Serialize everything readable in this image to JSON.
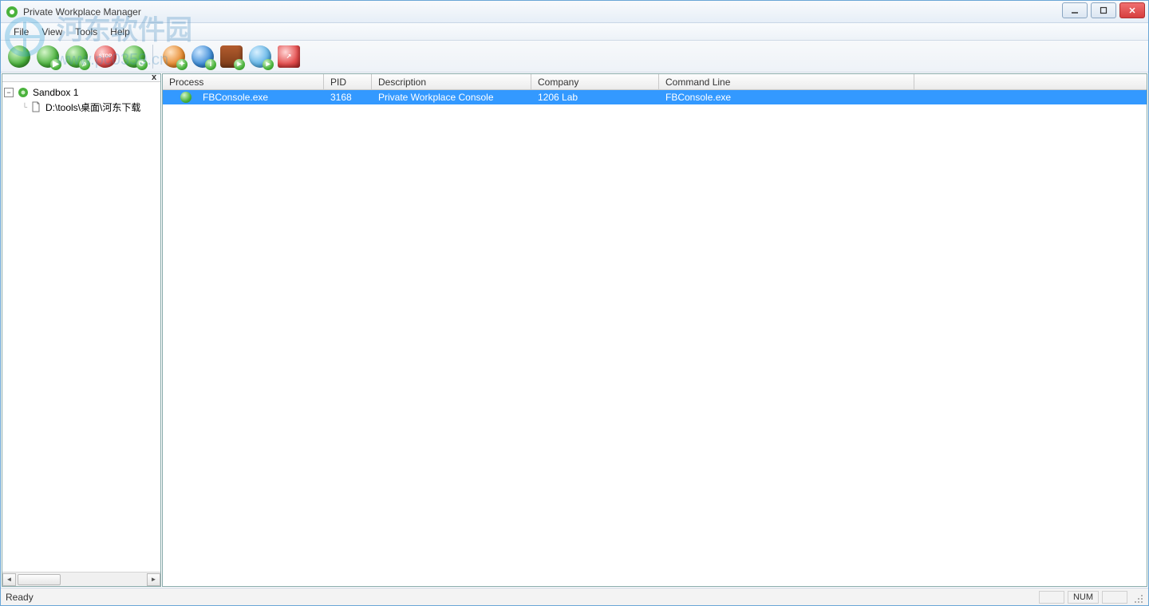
{
  "window": {
    "title": "Private Workplace Manager"
  },
  "menu": {
    "items": [
      "File",
      "View",
      "Tools",
      "Help"
    ]
  },
  "toolbar": {
    "buttons": [
      {
        "name": "new-sandbox",
        "style": "green",
        "glyph": ""
      },
      {
        "name": "play-sandbox",
        "style": "green",
        "glyph": "▶"
      },
      {
        "name": "explore-sandbox",
        "style": "green",
        "glyph": ""
      },
      {
        "name": "stop-sandbox",
        "style": "red",
        "glyph": "STOP"
      },
      {
        "name": "refresh",
        "style": "green",
        "glyph": "⟳"
      },
      {
        "sep": true
      },
      {
        "name": "settings",
        "style": "orange",
        "glyph": "✦"
      },
      {
        "name": "info",
        "style": "blue",
        "glyph": "i"
      },
      {
        "name": "catalog",
        "style": "green",
        "glyph": ""
      },
      {
        "name": "globe",
        "style": "blue",
        "glyph": ""
      },
      {
        "name": "pdf",
        "style": "red",
        "glyph": ""
      }
    ]
  },
  "tree": {
    "close_label": "x",
    "root_expanded_glyph": "−",
    "root": {
      "label": "Sandbox 1"
    },
    "child": {
      "label": "D:\\tools\\桌面\\河东下载"
    }
  },
  "list": {
    "columns": [
      "Process",
      "PID",
      "Description",
      "Company",
      "Command Line"
    ],
    "rows": [
      {
        "process": "FBConsole.exe",
        "pid": "3168",
        "description": "Private Workplace Console",
        "company": "1206 Lab",
        "cmd": "FBConsole.exe",
        "selected": true
      }
    ]
  },
  "status": {
    "ready": "Ready",
    "num": "NUM"
  },
  "watermark": {
    "line1": "河东软件园",
    "line2": "www.pc0359.cn"
  }
}
